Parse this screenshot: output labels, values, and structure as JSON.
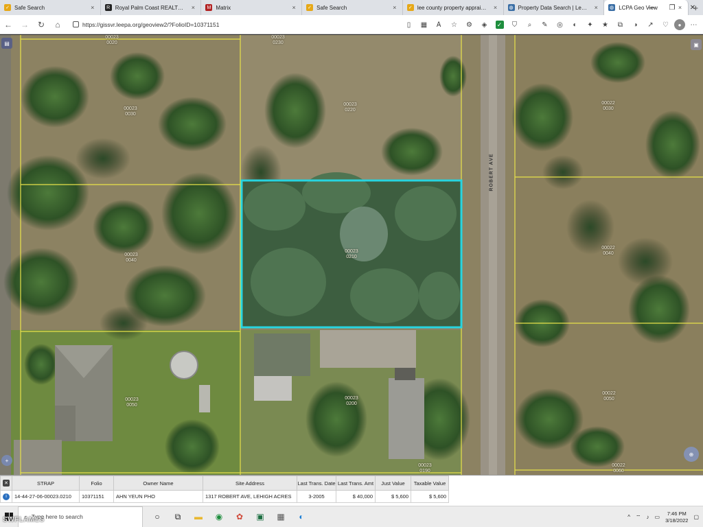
{
  "browser": {
    "tabs": [
      {
        "label": "Safe Search",
        "icon": "check-shield-icon",
        "color": "#e6a817"
      },
      {
        "label": "Royal Palm Coast REALTOR® A...",
        "icon": "realtor-logo-icon",
        "color": "#222222"
      },
      {
        "label": "Matrix",
        "icon": "matrix-logo-icon",
        "color": "#b22222"
      },
      {
        "label": "Safe Search",
        "icon": "check-shield-icon",
        "color": "#e6a817"
      },
      {
        "label": "lee county property appraiser, l...",
        "icon": "check-shield-icon",
        "color": "#e6a817"
      },
      {
        "label": "Property Data Search | Lee Coun...",
        "icon": "globe-icon",
        "color": "#3a6ea5"
      },
      {
        "label": "LCPA Geo View",
        "icon": "globe-icon",
        "color": "#3a6ea5"
      }
    ],
    "new_tab": "+",
    "url": "https://gissvr.leepa.org/geoview2/?FolioID=10371151"
  },
  "map": {
    "street_name": "ROBERT AVE",
    "parcels": [
      {
        "label": "00023\n0020"
      },
      {
        "label": "00023\n0230"
      },
      {
        "label": "00023\n0030"
      },
      {
        "label": "00023\n0220"
      },
      {
        "label": "00022\n0030"
      },
      {
        "label": "00023\n0040"
      },
      {
        "label": "00023\n0210"
      },
      {
        "label": "00022\n0040"
      },
      {
        "label": "00023\n0050"
      },
      {
        "label": "00023\n0200"
      },
      {
        "label": "00022\n0050"
      },
      {
        "label": "00023\n0190"
      },
      {
        "label": "00022\n0060"
      }
    ],
    "parcel_line_color": "#e8e24a",
    "selected_outline_color": "#27d4e0"
  },
  "attributes": {
    "columns": [
      "STRAP",
      "Folio",
      "Owner Name",
      "Site Address",
      "Last Trans. Date",
      "Last Trans. Amt",
      "Just Value",
      "Taxable Value"
    ],
    "row": [
      "14-44-27-06-00023.0210",
      "10371151",
      "AHN YEUN PHO",
      "1317 ROBERT AVE, LEHIGH ACRES",
      "3-2005",
      "$ 40,000",
      "$ 5,600",
      "$ 5,600"
    ]
  },
  "taskbar": {
    "search_placeholder": "Type here to search",
    "time": "7:46 PM",
    "date": "3/18/2022"
  },
  "watermark": "SWFLAMLS"
}
